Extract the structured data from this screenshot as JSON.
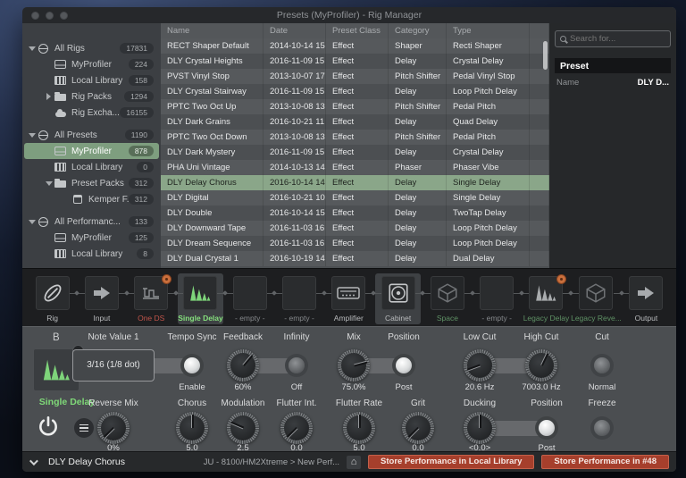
{
  "window": {
    "title": "Presets (MyProfiler) - Rig Manager"
  },
  "colors": {
    "selection_green": "#7e9e7f",
    "row_selection_green": "#8aa689",
    "active_green_text": "#85e07d",
    "muted_green_text": "#5f9165",
    "locked_red_text": "#c0544a",
    "store_button_red": "#a63f2c"
  },
  "sidebar": {
    "items": [
      {
        "label": "All Rigs",
        "count": "17831",
        "icon": "globe",
        "indent": 0,
        "arrow": "down",
        "selected": false,
        "group": true
      },
      {
        "label": "MyProfiler",
        "count": "224",
        "icon": "amp",
        "indent": 1,
        "arrow": null,
        "selected": false
      },
      {
        "label": "Local Library",
        "count": "158",
        "icon": "lib",
        "indent": 1,
        "arrow": null,
        "selected": false
      },
      {
        "label": "Rig Packs",
        "count": "1294",
        "icon": "folder",
        "indent": 1,
        "arrow": "right",
        "selected": false
      },
      {
        "label": "Rig Excha...",
        "count": "16155",
        "icon": "cloud",
        "indent": 1,
        "arrow": null,
        "selected": false
      },
      {
        "label": "All Presets",
        "count": "1190",
        "icon": "globe",
        "indent": 0,
        "arrow": "down",
        "selected": false,
        "group": true
      },
      {
        "label": "MyProfiler",
        "count": "878",
        "icon": "amp",
        "indent": 1,
        "arrow": null,
        "selected": true
      },
      {
        "label": "Local Library",
        "count": "0",
        "icon": "lib",
        "indent": 1,
        "arrow": null,
        "selected": false
      },
      {
        "label": "Preset Packs",
        "count": "312",
        "icon": "folder",
        "indent": 1,
        "arrow": "down",
        "selected": false
      },
      {
        "label": "Kemper F...",
        "count": "312",
        "icon": "box",
        "indent": 2,
        "arrow": null,
        "selected": false
      },
      {
        "label": "All Performanc...",
        "count": "133",
        "icon": "globe",
        "indent": 0,
        "arrow": "down",
        "selected": false,
        "group": true
      },
      {
        "label": "MyProfiler",
        "count": "125",
        "icon": "amp",
        "indent": 1,
        "arrow": null,
        "selected": false
      },
      {
        "label": "Local Library",
        "count": "8",
        "icon": "lib",
        "indent": 1,
        "arrow": null,
        "selected": false
      }
    ]
  },
  "table": {
    "columns": [
      "Name",
      "Date",
      "Preset Class",
      "Category",
      "Type"
    ],
    "rows": [
      {
        "name": "RECT Shaper Default",
        "date": "2014-10-14 15:...",
        "preset_class": "Effect",
        "category": "Shaper",
        "type": "Recti Shaper",
        "selected": false
      },
      {
        "name": "DLY Crystal Heights",
        "date": "2016-11-09 15:...",
        "preset_class": "Effect",
        "category": "Delay",
        "type": "Crystal Delay",
        "selected": false
      },
      {
        "name": "PVST Vinyl Stop",
        "date": "2013-10-07 17:...",
        "preset_class": "Effect",
        "category": "Pitch Shifter",
        "type": "Pedal Vinyl Stop",
        "selected": false
      },
      {
        "name": "DLY Crystal Stairway",
        "date": "2016-11-09 15:...",
        "preset_class": "Effect",
        "category": "Delay",
        "type": "Loop Pitch Delay",
        "selected": false
      },
      {
        "name": "PPTC Two Oct Up",
        "date": "2013-10-08 13...",
        "preset_class": "Effect",
        "category": "Pitch Shifter",
        "type": "Pedal Pitch",
        "selected": false
      },
      {
        "name": "DLY Dark Grains",
        "date": "2016-10-21 11:...",
        "preset_class": "Effect",
        "category": "Delay",
        "type": "Quad Delay",
        "selected": false
      },
      {
        "name": "PPTC Two Oct Down",
        "date": "2013-10-08 13...",
        "preset_class": "Effect",
        "category": "Pitch Shifter",
        "type": "Pedal Pitch",
        "selected": false
      },
      {
        "name": "DLY Dark Mystery",
        "date": "2016-11-09 15:...",
        "preset_class": "Effect",
        "category": "Delay",
        "type": "Crystal Delay",
        "selected": false
      },
      {
        "name": "PHA Uni Vintage",
        "date": "2014-10-13 14:...",
        "preset_class": "Effect",
        "category": "Phaser",
        "type": "Phaser Vibe",
        "selected": false
      },
      {
        "name": "DLY Delay Chorus",
        "date": "2016-10-14 14:...",
        "preset_class": "Effect",
        "category": "Delay",
        "type": "Single Delay",
        "selected": true
      },
      {
        "name": "DLY Digital",
        "date": "2016-10-21 10:...",
        "preset_class": "Effect",
        "category": "Delay",
        "type": "Single Delay",
        "selected": false
      },
      {
        "name": "DLY Double",
        "date": "2016-10-14 15:...",
        "preset_class": "Effect",
        "category": "Delay",
        "type": "TwoTap Delay",
        "selected": false
      },
      {
        "name": "DLY Downward Tape",
        "date": "2016-11-03 16:...",
        "preset_class": "Effect",
        "category": "Delay",
        "type": "Loop Pitch Delay",
        "selected": false
      },
      {
        "name": "DLY Dream Sequence",
        "date": "2016-11-03 16:...",
        "preset_class": "Effect",
        "category": "Delay",
        "type": "Loop Pitch Delay",
        "selected": false
      },
      {
        "name": "DLY Dual Crystal 1",
        "date": "2016-10-19 14:...",
        "preset_class": "Effect",
        "category": "Delay",
        "type": "Dual Delay",
        "selected": false
      }
    ]
  },
  "inspector": {
    "search_placeholder": "Search for...",
    "section_title": "Preset",
    "name_label": "Name",
    "name_value": "DLY D..."
  },
  "chain": {
    "slots": [
      {
        "label": "Rig",
        "icon": "rig",
        "style": "normal"
      },
      {
        "label": "Input",
        "icon": "arrow",
        "style": "normal"
      },
      {
        "label": "One DS",
        "icon": "distortion",
        "style": "locked-red",
        "badge": true
      },
      {
        "label": "Single Delay",
        "icon": "delay",
        "style": "active-green",
        "selected": true,
        "icon_color": "#7ed47a"
      },
      {
        "label": "- empty -",
        "icon": "empty",
        "style": "empty"
      },
      {
        "label": "- empty -",
        "icon": "empty",
        "style": "empty"
      },
      {
        "label": "Amplifier",
        "icon": "amplifier",
        "style": "normal"
      },
      {
        "label": "Cabinet",
        "icon": "cabinet",
        "style": "normal",
        "selected": true
      },
      {
        "label": "Space",
        "icon": "cube",
        "style": "muted-green",
        "dim": true
      },
      {
        "label": "- empty -",
        "icon": "empty",
        "style": "empty"
      },
      {
        "label": "Legacy Delay",
        "icon": "delay",
        "style": "muted-green",
        "badge": true,
        "icon_color": "#a9acae"
      },
      {
        "label": "Legacy Reve...",
        "icon": "cube",
        "style": "muted-green",
        "dim": true
      },
      {
        "label": "Output",
        "icon": "arrow",
        "style": "normal"
      }
    ]
  },
  "editor": {
    "slot_key": "B",
    "module_name": "Single Delay",
    "rows": [
      [
        {
          "label": "Note Value 1",
          "type": "valuebox",
          "value": "3/16 (1/8 dot)"
        },
        {
          "label": "Tempo Sync",
          "type": "toggle",
          "state": "on",
          "value": "Enable"
        },
        {
          "label": "Feedback",
          "type": "knob",
          "value": "60%",
          "angle": 40
        },
        {
          "label": "Infinity",
          "type": "toggle",
          "state": "off",
          "value": "Off"
        },
        {
          "label": "Mix",
          "type": "knob",
          "value": "75.0%",
          "angle": 75
        },
        {
          "label": "Position",
          "type": "toggle",
          "state": "on",
          "value": "Post"
        },
        {
          "label": "Low Cut",
          "type": "knob",
          "value": "20.6 Hz",
          "angle": -110
        },
        {
          "label": "High Cut",
          "type": "knob",
          "value": "7003.0 Hz",
          "angle": 25
        },
        {
          "label": "Cut",
          "type": "toggle",
          "state": "off",
          "value": "Normal"
        }
      ],
      [
        {
          "label": "Reverse Mix",
          "type": "knob",
          "value": "0%",
          "angle": -135
        },
        {
          "label": "Chorus",
          "type": "knob",
          "value": "5.0",
          "angle": 0
        },
        {
          "label": "Modulation",
          "type": "knob",
          "value": "2.5",
          "angle": -67
        },
        {
          "label": "Flutter Int.",
          "type": "knob",
          "value": "0.0",
          "angle": -135
        },
        {
          "label": "Flutter Rate",
          "type": "knob",
          "value": "5.0",
          "angle": 0
        },
        {
          "label": "Grit",
          "type": "knob",
          "value": "0.0",
          "angle": -135
        },
        {
          "label": "Ducking",
          "type": "knob",
          "value": "<0.0>",
          "angle": 0
        },
        {
          "label": "Position",
          "type": "toggle",
          "state": "on",
          "value": "Post"
        },
        {
          "label": "Freeze",
          "type": "toggle",
          "state": "off",
          "value": ""
        }
      ]
    ]
  },
  "statusbar": {
    "preset_name": "DLY Delay Chorus",
    "context": "JU - 8100/HM2Xtreme > New Perf...",
    "home_glyph": "⌂",
    "store_local_label": "Store Performance in Local Library",
    "store_slot_label": "Store Performance in #48"
  }
}
